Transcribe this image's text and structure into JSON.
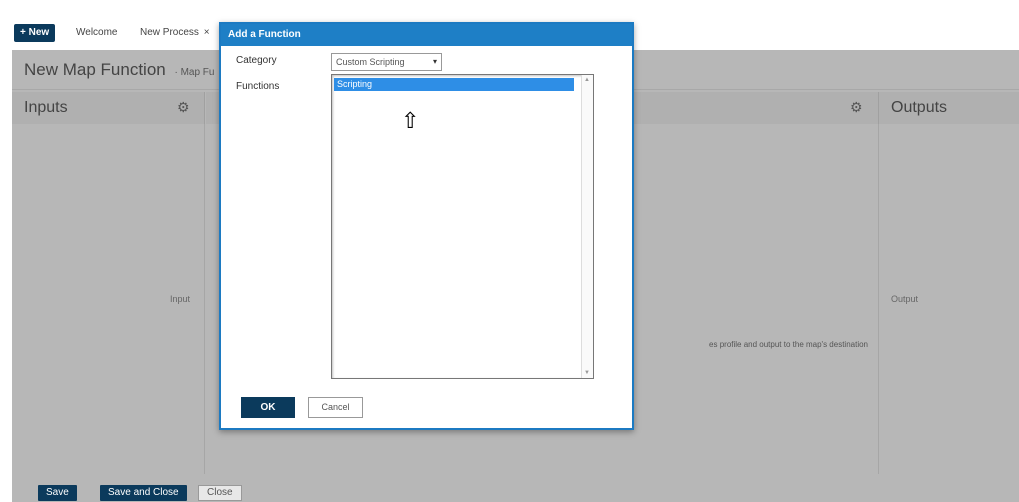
{
  "tabbar": {
    "new_label": "+ New",
    "tabs": [
      {
        "label": "Welcome"
      },
      {
        "label": "New Process",
        "close": "×"
      }
    ]
  },
  "editor": {
    "title": "New Map Function",
    "subtitle": "· Map Fu",
    "columns": {
      "inputs": "Inputs",
      "outputs": "Outputs"
    },
    "input_item": "Input",
    "output_item": "Output",
    "middle_description": "es profile and output to the map's destination"
  },
  "bottom": {
    "save": "Save",
    "save_and_close": "Save and Close",
    "close": "Close"
  },
  "dialog": {
    "title": "Add a Function",
    "category_label": "Category",
    "category_value": "Custom Scripting",
    "functions_label": "Functions",
    "functions": [
      "Scripting"
    ],
    "ok": "OK",
    "cancel": "Cancel"
  },
  "icons": {
    "gear": "gear-icon",
    "dropdown": "chevron-down-icon",
    "cursor": "up-arrow-cursor-icon"
  },
  "colors": {
    "accent": "#1e7fc6",
    "dark_button": "#0b3a5c",
    "selection": "#2e8ee6",
    "overlay": "#b7b7b7"
  }
}
